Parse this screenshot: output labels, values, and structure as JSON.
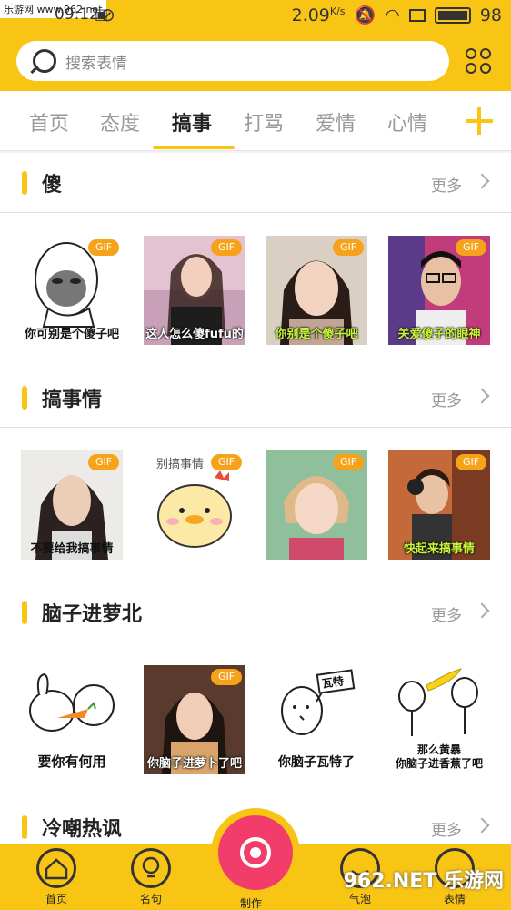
{
  "watermark_top": "乐游网 www.962.net",
  "status": {
    "time": "09:12",
    "speed": "2.09",
    "speed_unit": "K/s",
    "battery": "98"
  },
  "search": {
    "placeholder": "搜索表情"
  },
  "tabs": [
    "首页",
    "态度",
    "搞事",
    "打骂",
    "爱情",
    "心情"
  ],
  "active_tab": "搞事",
  "more_label": "更多",
  "sections": [
    {
      "title": "傻",
      "items": [
        {
          "caption": "你可别是个傻子吧",
          "gif": "GIF"
        },
        {
          "caption": "这人怎么傻fufu的",
          "gif": "GIF"
        },
        {
          "caption": "你别是个傻子吧",
          "gif": "GIF"
        },
        {
          "caption": "关爱傻子的眼神",
          "gif": "GIF"
        }
      ]
    },
    {
      "title": "搞事情",
      "items": [
        {
          "caption": "不要给我搞事情",
          "gif": "GIF"
        },
        {
          "caption": "别搞事情",
          "gif": "GIF"
        },
        {
          "caption": "",
          "gif": "GIF"
        },
        {
          "caption": "快起来搞事情",
          "gif": "GIF"
        }
      ]
    },
    {
      "title": "脑子进萝北",
      "items": [
        {
          "caption": "要你有何用",
          "gif": ""
        },
        {
          "caption": "你脑子进萝卜了吧",
          "gif": "GIF"
        },
        {
          "caption": "你脑子瓦特了",
          "gif": "",
          "sign": "瓦特"
        },
        {
          "caption": "那么黄暴\n你脑子进香蕉了吧",
          "gif": ""
        }
      ]
    },
    {
      "title": "冷嘲热讽",
      "items": []
    }
  ],
  "bottom_nav": {
    "home": "首页",
    "quotes": "名句",
    "make": "制作",
    "bubble": "气泡",
    "fifth": "表情"
  },
  "brand_watermark": "962.NET 乐游网",
  "colors": {
    "accent": "#f9c515",
    "gif_badge": "#f7a21b",
    "fab": "#f23d6b"
  }
}
